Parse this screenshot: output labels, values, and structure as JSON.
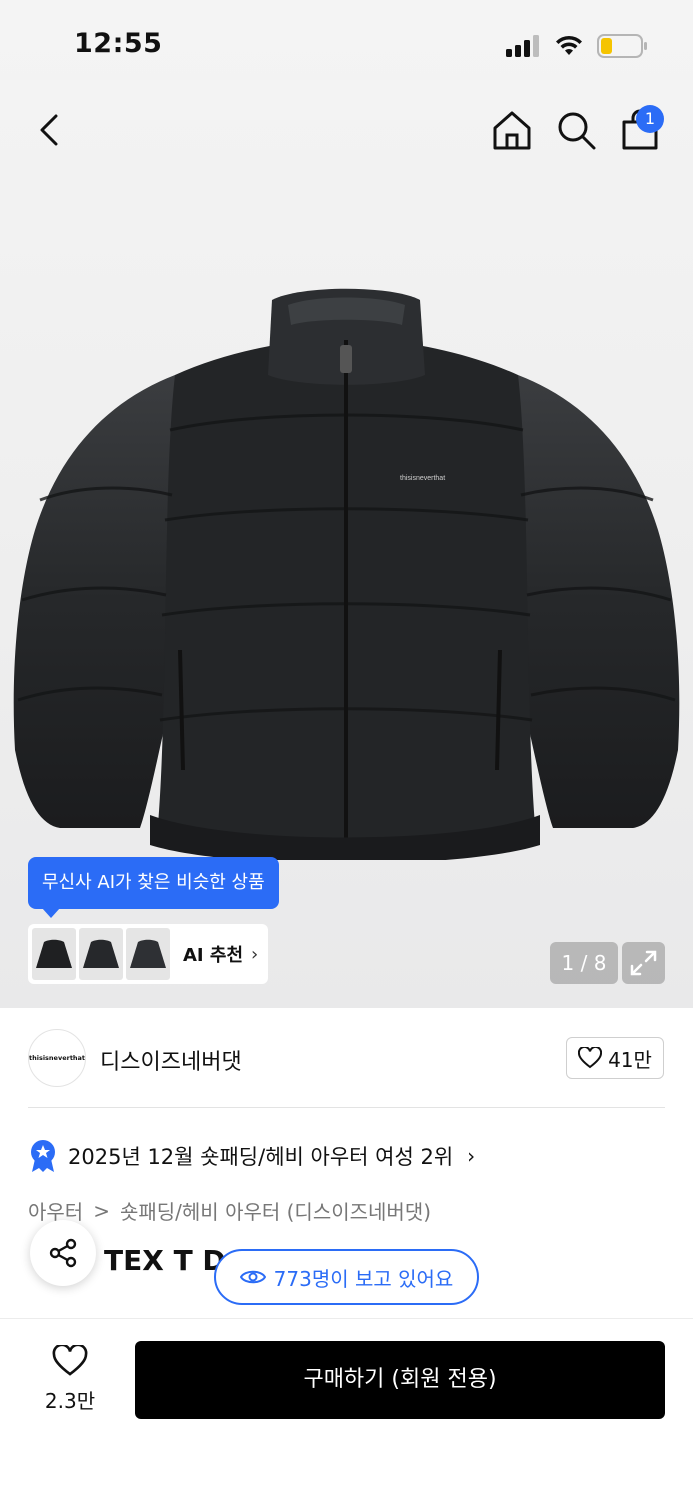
{
  "status_bar": {
    "time": "12:55"
  },
  "nav": {
    "cart_count": "1"
  },
  "ai": {
    "bubble_text": "무신사 AI가 찾은 비슷한 상품",
    "recommend_label": "AI 추천",
    "chevron": "›"
  },
  "gallery": {
    "pager": "1 / 8"
  },
  "brand": {
    "logo_text": "thisisneverthat",
    "name": "디스이즈네버댓",
    "likes": "41만"
  },
  "ranking": {
    "text": "2025년 12월 숏패딩/헤비 아우터 여성 2위"
  },
  "category": {
    "level1": "아우터",
    "separator": ">",
    "level2": "숏패딩/헤비 아우터 (디스이즈네버댓)"
  },
  "product": {
    "title_visible": "TEX T Do"
  },
  "viewers": {
    "text": "773명이 보고 있어요"
  },
  "bottom": {
    "wish_count": "2.3만",
    "buy_label": "구매하기 (회원 전용)"
  },
  "colors": {
    "accent": "#2b6cf6",
    "buy_button": "#000000"
  },
  "icons": [
    "back-icon",
    "home-icon",
    "search-icon",
    "cart-icon",
    "expand-icon",
    "heart-icon",
    "share-icon",
    "eye-icon",
    "rank-badge-icon"
  ]
}
